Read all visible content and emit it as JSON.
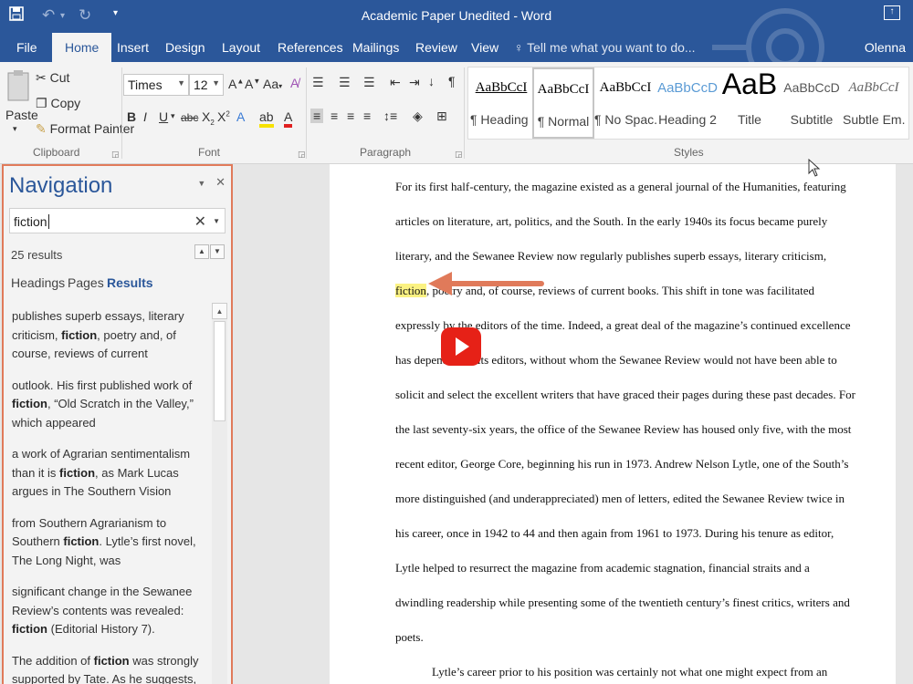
{
  "window": {
    "title": "Academic Paper Unedited - Word",
    "user": "Olenna"
  },
  "tabs": [
    "File",
    "Home",
    "Insert",
    "Design",
    "Layout",
    "References",
    "Mailings",
    "Review",
    "View"
  ],
  "tell_me": "Tell me what you want to do...",
  "clipboard": {
    "paste": "Paste",
    "cut": "Cut",
    "copy": "Copy",
    "format_painter": "Format Painter",
    "label": "Clipboard"
  },
  "font": {
    "family": "Times",
    "size": "12",
    "label": "Font",
    "case_btn": "Aa"
  },
  "paragraph": {
    "label": "Paragraph"
  },
  "styles": {
    "label": "Styles",
    "items": [
      {
        "sample": "AaBbCcI",
        "name": "¶ Heading 1"
      },
      {
        "sample": "AaBbCcI",
        "name": "¶ Normal"
      },
      {
        "sample": "AaBbCcI",
        "name": "¶ No Spac..."
      },
      {
        "sample": "AaBbCcD",
        "name": "Heading 2"
      },
      {
        "sample": "AaB",
        "name": "Title"
      },
      {
        "sample": "AaBbCcD",
        "name": "Subtitle"
      },
      {
        "sample": "AaBbCcI",
        "name": "Subtle Em..."
      }
    ]
  },
  "navigation": {
    "title": "Navigation",
    "search_value": "fiction",
    "results_count": "25 results",
    "tabs": [
      "Headings",
      "Pages",
      "Results"
    ],
    "results": [
      {
        "before": "publishes superb essays, literary criticism, ",
        "match": "fiction",
        "after": ", poetry and, of course, reviews of current"
      },
      {
        "before": "outlook.  His first published work of ",
        "match": "fiction",
        "after": ", “Old Scratch in the Valley,” which appeared"
      },
      {
        "before": "a work of Agrarian sentimentalism than it is ",
        "match": "fiction",
        "after": ", as Mark Lucas argues in The Southern Vision"
      },
      {
        "before": "from Southern Agrarianism to Southern ",
        "match": "fiction",
        "after": ". Lytle’s first novel, The Long Night, was"
      },
      {
        "before": "significant change in the Sewanee Review’s contents was revealed: ",
        "match": "fiction",
        "after": " (Editorial History 7)."
      },
      {
        "before": "The addition of ",
        "match": "fiction",
        "after": " was strongly supported by Tate. As he suggests, “good creative work is a"
      }
    ]
  },
  "document": {
    "lines": [
      "For its first half-century, the magazine existed as a general journal of the Humanities, featuring",
      "articles on literature, art, politics, and the South. In the early 1940s its focus became purely",
      "literary, and the Sewanee Review now regularly publishes superb essays, literary criticism,",
      "fiction, poetry and, of course, reviews of current books. This shift in tone was facilitated",
      "expressly by the editors of the time. Indeed, a great deal of the magazine’s continued excellence",
      "has depended on its editors, without whom the Sewanee Review would not have been able to",
      "solicit and select the excellent writers that have graced their pages during these past decades. For",
      "the last seventy-six years, the office of the Sewanee Review has housed only five, with the most",
      "recent editor, George Core, beginning his run in 1973. Andrew Nelson Lytle, one of the South’s",
      "more distinguished (and underappreciated) men of letters, edited the Sewanee Review twice in",
      "his career, once in 1942 to 44 and then again from 1961 to 1973. During his tenure as editor,",
      "Lytle helped to resurrect the magazine from academic stagnation, financial straits and a",
      "dwindling readership while presenting some of the twentieth century’s finest critics, writers and",
      "poets.",
      "Lytle’s career prior to his position was certainly not what one might expect from an"
    ],
    "highlight": "fiction"
  },
  "colors": {
    "ribbon_blue": "#2b579a",
    "callout": "#e07a5a",
    "highlight": "#fbf282",
    "play": "#e62117"
  }
}
